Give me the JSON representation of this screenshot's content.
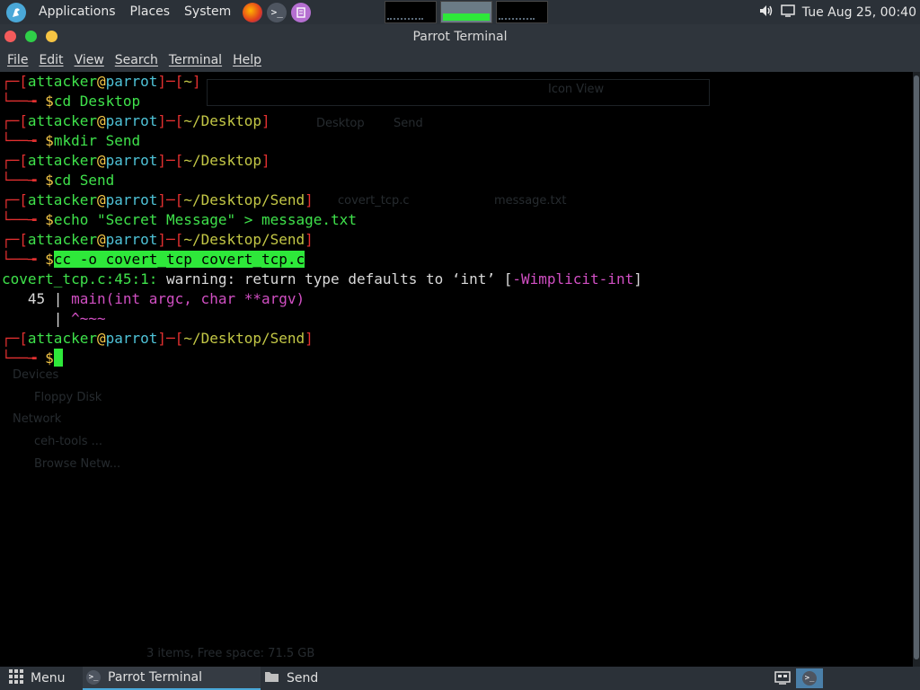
{
  "top_panel": {
    "menus": [
      "Applications",
      "Places",
      "System"
    ],
    "clock": "Tue Aug 25, 00:40"
  },
  "window": {
    "title": "Parrot Terminal",
    "menu": [
      "File",
      "Edit",
      "View",
      "Search",
      "Terminal",
      "Help"
    ]
  },
  "terminal": {
    "user": "attacker",
    "at": "@",
    "host": "parrot",
    "paths": [
      "~",
      "~/Desktop",
      "~/Desktop",
      "~/Desktop/Send",
      "~/Desktop/Send",
      "~/Desktop/Send"
    ],
    "commands": [
      "cd Desktop",
      "mkdir Send",
      "cd Send",
      "echo \"Secret Message\" > message.txt",
      "cc -o covert_tcp covert_tcp.c"
    ],
    "warning": {
      "location": "covert_tcp.c:45:1:",
      "text": " warning: return type defaults to ‘int’ [",
      "flag": "-Wimplicit-int",
      "close": "]",
      "source_line_no": "   45 | ",
      "source_code": "main(int argc, char **argv)",
      "caret_line": "      | ",
      "caret": "^~~~"
    }
  },
  "background_window": {
    "tabs": [
      "Desktop",
      "Send"
    ],
    "view_mode": "Icon View",
    "files": [
      "covert_tcp.c",
      "message.txt"
    ],
    "sidebar": [
      "Devices",
      "Floppy Disk",
      "Network",
      "ceh-tools ...",
      "Browse Netw..."
    ],
    "status": "3 items, Free space: 71.5 GB"
  },
  "bottom_panel": {
    "menu_label": "Menu",
    "tasks": [
      "Parrot Terminal",
      "Send"
    ]
  },
  "colors": {
    "prompt_bracket": "#e23030",
    "prompt_user": "#3fe24b",
    "prompt_host": "#4fc3d8",
    "prompt_path": "#c4c846",
    "highlight": "#2ee83a",
    "panel_bg": "#2b3138"
  }
}
